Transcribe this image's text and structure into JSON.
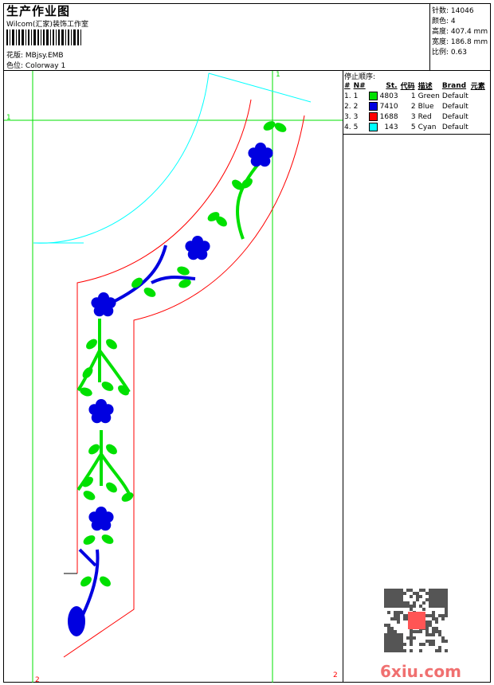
{
  "header": {
    "title": "生产作业图",
    "company": "Wilcom(汇家)装饰工作室",
    "design_label": "花版:",
    "design_value": "MBjsy.EMB",
    "colorway_label": "色位:",
    "colorway_value": "Colorway 1"
  },
  "info": [
    {
      "label": "针数:",
      "value": "14046"
    },
    {
      "label": "颜色:",
      "value": "4"
    },
    {
      "label": "高度:",
      "value": "407.4 mm"
    },
    {
      "label": "宽度:",
      "value": "186.8 mm"
    },
    {
      "label": "比例:",
      "value": "0.63"
    }
  ],
  "stops": {
    "title": "停止顺序:",
    "columns": [
      "#",
      "N#",
      "St.",
      "代码",
      "描述",
      "Brand",
      "元素"
    ],
    "rows": [
      {
        "idx": "1.",
        "n": "1",
        "color": "#00e000",
        "st": "4803",
        "code": "1",
        "desc": "Green",
        "brand": "Default"
      },
      {
        "idx": "2.",
        "n": "2",
        "color": "#0000e0",
        "st": "7410",
        "code": "2",
        "desc": "Blue",
        "brand": "Default"
      },
      {
        "idx": "3.",
        "n": "3",
        "color": "#ff0000",
        "st": "1688",
        "code": "3",
        "desc": "Red",
        "brand": "Default"
      },
      {
        "idx": "4.",
        "n": "5",
        "color": "#00ffff",
        "st": "143",
        "code": "5",
        "desc": "Cyan",
        "brand": "Default"
      }
    ]
  },
  "markers": {
    "green_1a": "1",
    "green_1b": "1",
    "red_2a": "2",
    "red_2b": "2"
  },
  "watermark": "6xiu.com"
}
